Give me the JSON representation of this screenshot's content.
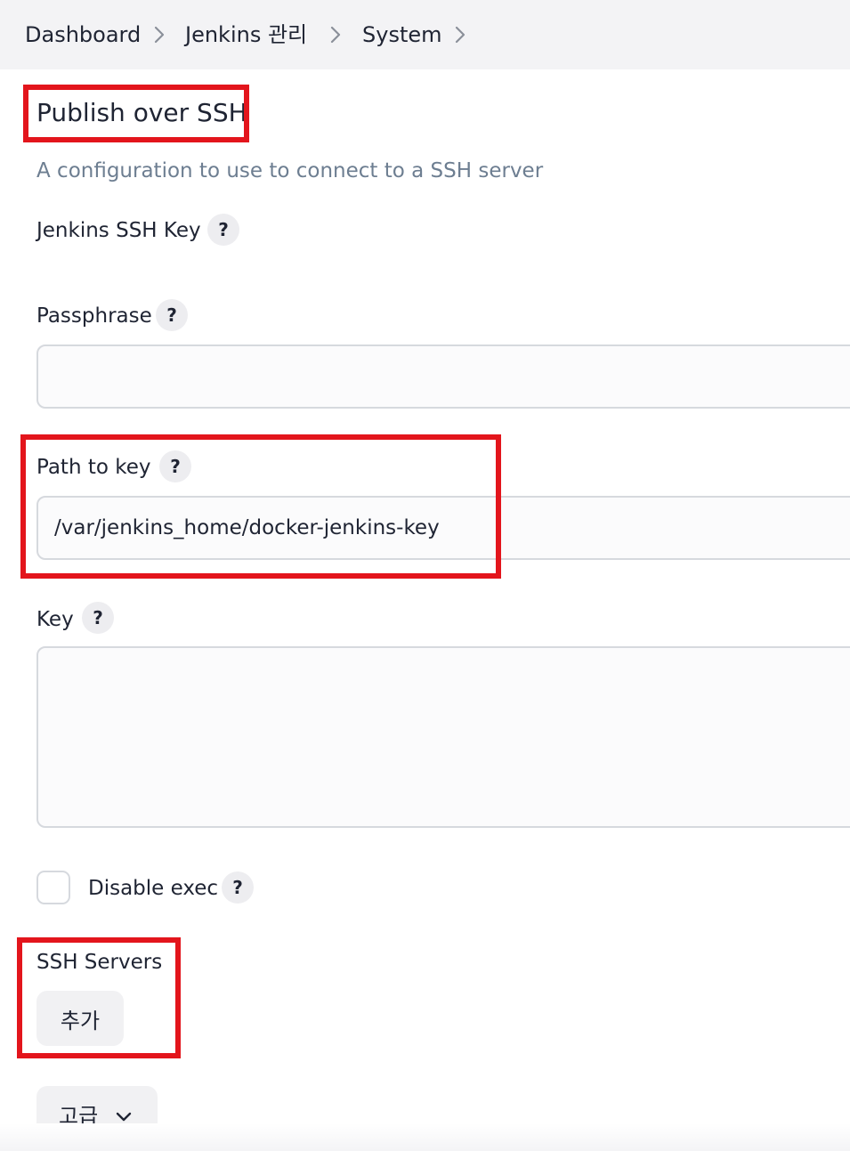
{
  "breadcrumb": {
    "items": [
      "Dashboard",
      "Jenkins 관리",
      "System"
    ]
  },
  "section": {
    "title": "Publish over SSH",
    "description": "A configuration to use to connect to a SSH server"
  },
  "fields": {
    "jenkins_ssh_key_label": "Jenkins SSH Key",
    "passphrase_label": "Passphrase",
    "passphrase_value": "",
    "path_to_key_label": "Path to key",
    "path_to_key_value": "/var/jenkins_home/docker-jenkins-key",
    "key_label": "Key",
    "key_value": "",
    "disable_exec_label": "Disable exec",
    "disable_exec_checked": false,
    "ssh_servers_label": "SSH Servers"
  },
  "help_label": "?",
  "buttons": {
    "add_label": "추가",
    "advanced_label": "고급"
  },
  "icons": {
    "breadcrumb_separator": "chevron-right-icon",
    "advanced_toggle": "chevron-down-icon"
  },
  "colors": {
    "annotation_border": "#e3151c",
    "description_text": "#6d7e91",
    "topbar_background": "#f3f3f5"
  }
}
